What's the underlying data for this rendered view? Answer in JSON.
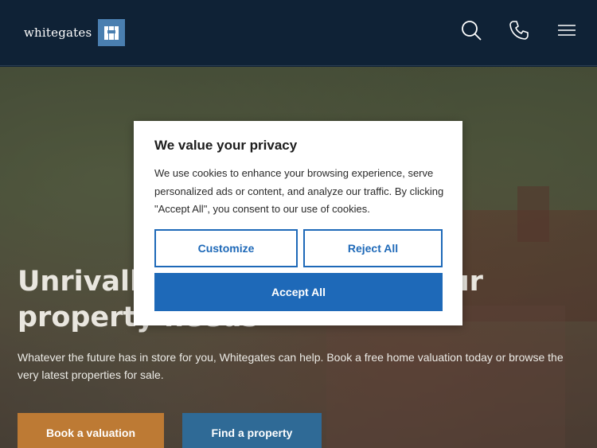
{
  "header": {
    "logo_text": "whitegates",
    "icons": [
      "search-icon",
      "phone-icon",
      "menu-icon"
    ]
  },
  "hero": {
    "title": "Unrivalled service for all your property needs",
    "description": "Whatever the future has in store for you, Whitegates can help. Book a free home valuation today or browse the very latest properties for sale.",
    "buttons": {
      "valuation": "Book a valuation",
      "find": "Find a property"
    }
  },
  "consent": {
    "title": "We value your privacy",
    "text": "We use cookies to enhance your browsing experience, serve personalized ads or content, and analyze our traffic. By clicking \"Accept All\", you consent to our use of cookies.",
    "customize": "Customize",
    "reject": "Reject All",
    "accept": "Accept All"
  },
  "colors": {
    "header_bg": "#0f2236",
    "logo_mark": "#4a7fb0",
    "valuation_button": "#bd7a34",
    "find_button": "#2f6a96",
    "consent_accent": "#1e69b8"
  }
}
